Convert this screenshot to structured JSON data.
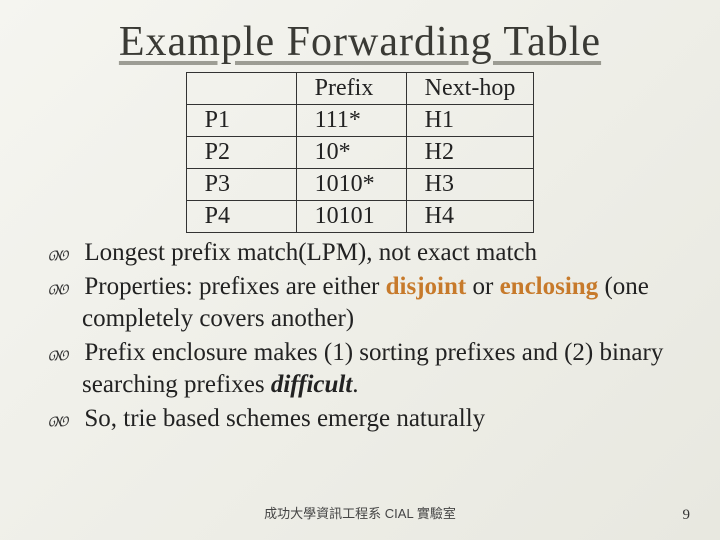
{
  "title": "Example Forwarding Table",
  "table": {
    "headers": [
      "",
      "Prefix",
      "Next-hop"
    ],
    "rows": [
      [
        "P1",
        "111*",
        "H1"
      ],
      [
        "P2",
        "10*",
        "H2"
      ],
      [
        "P3",
        "1010*",
        "H3"
      ],
      [
        "P4",
        "10101",
        "H4"
      ]
    ]
  },
  "bullets": [
    {
      "pre": "Longest prefix match(LPM), not exact match",
      "hl": "",
      "post": ""
    },
    {
      "pre": "Properties: prefixes are either ",
      "hl": "disjoint",
      "mid": " or ",
      "hl2": "enclosing",
      "post": " (one completely covers another)"
    },
    {
      "pre": "Prefix enclosure makes (1) sorting prefixes and (2) binary searching prefixes ",
      "em": "difficult",
      "post": "."
    },
    {
      "pre": "So, trie based schemes emerge naturally",
      "hl": "",
      "post": ""
    }
  ],
  "footer": "成功大學資訊工程系    CIAL 實驗室",
  "page": "9"
}
